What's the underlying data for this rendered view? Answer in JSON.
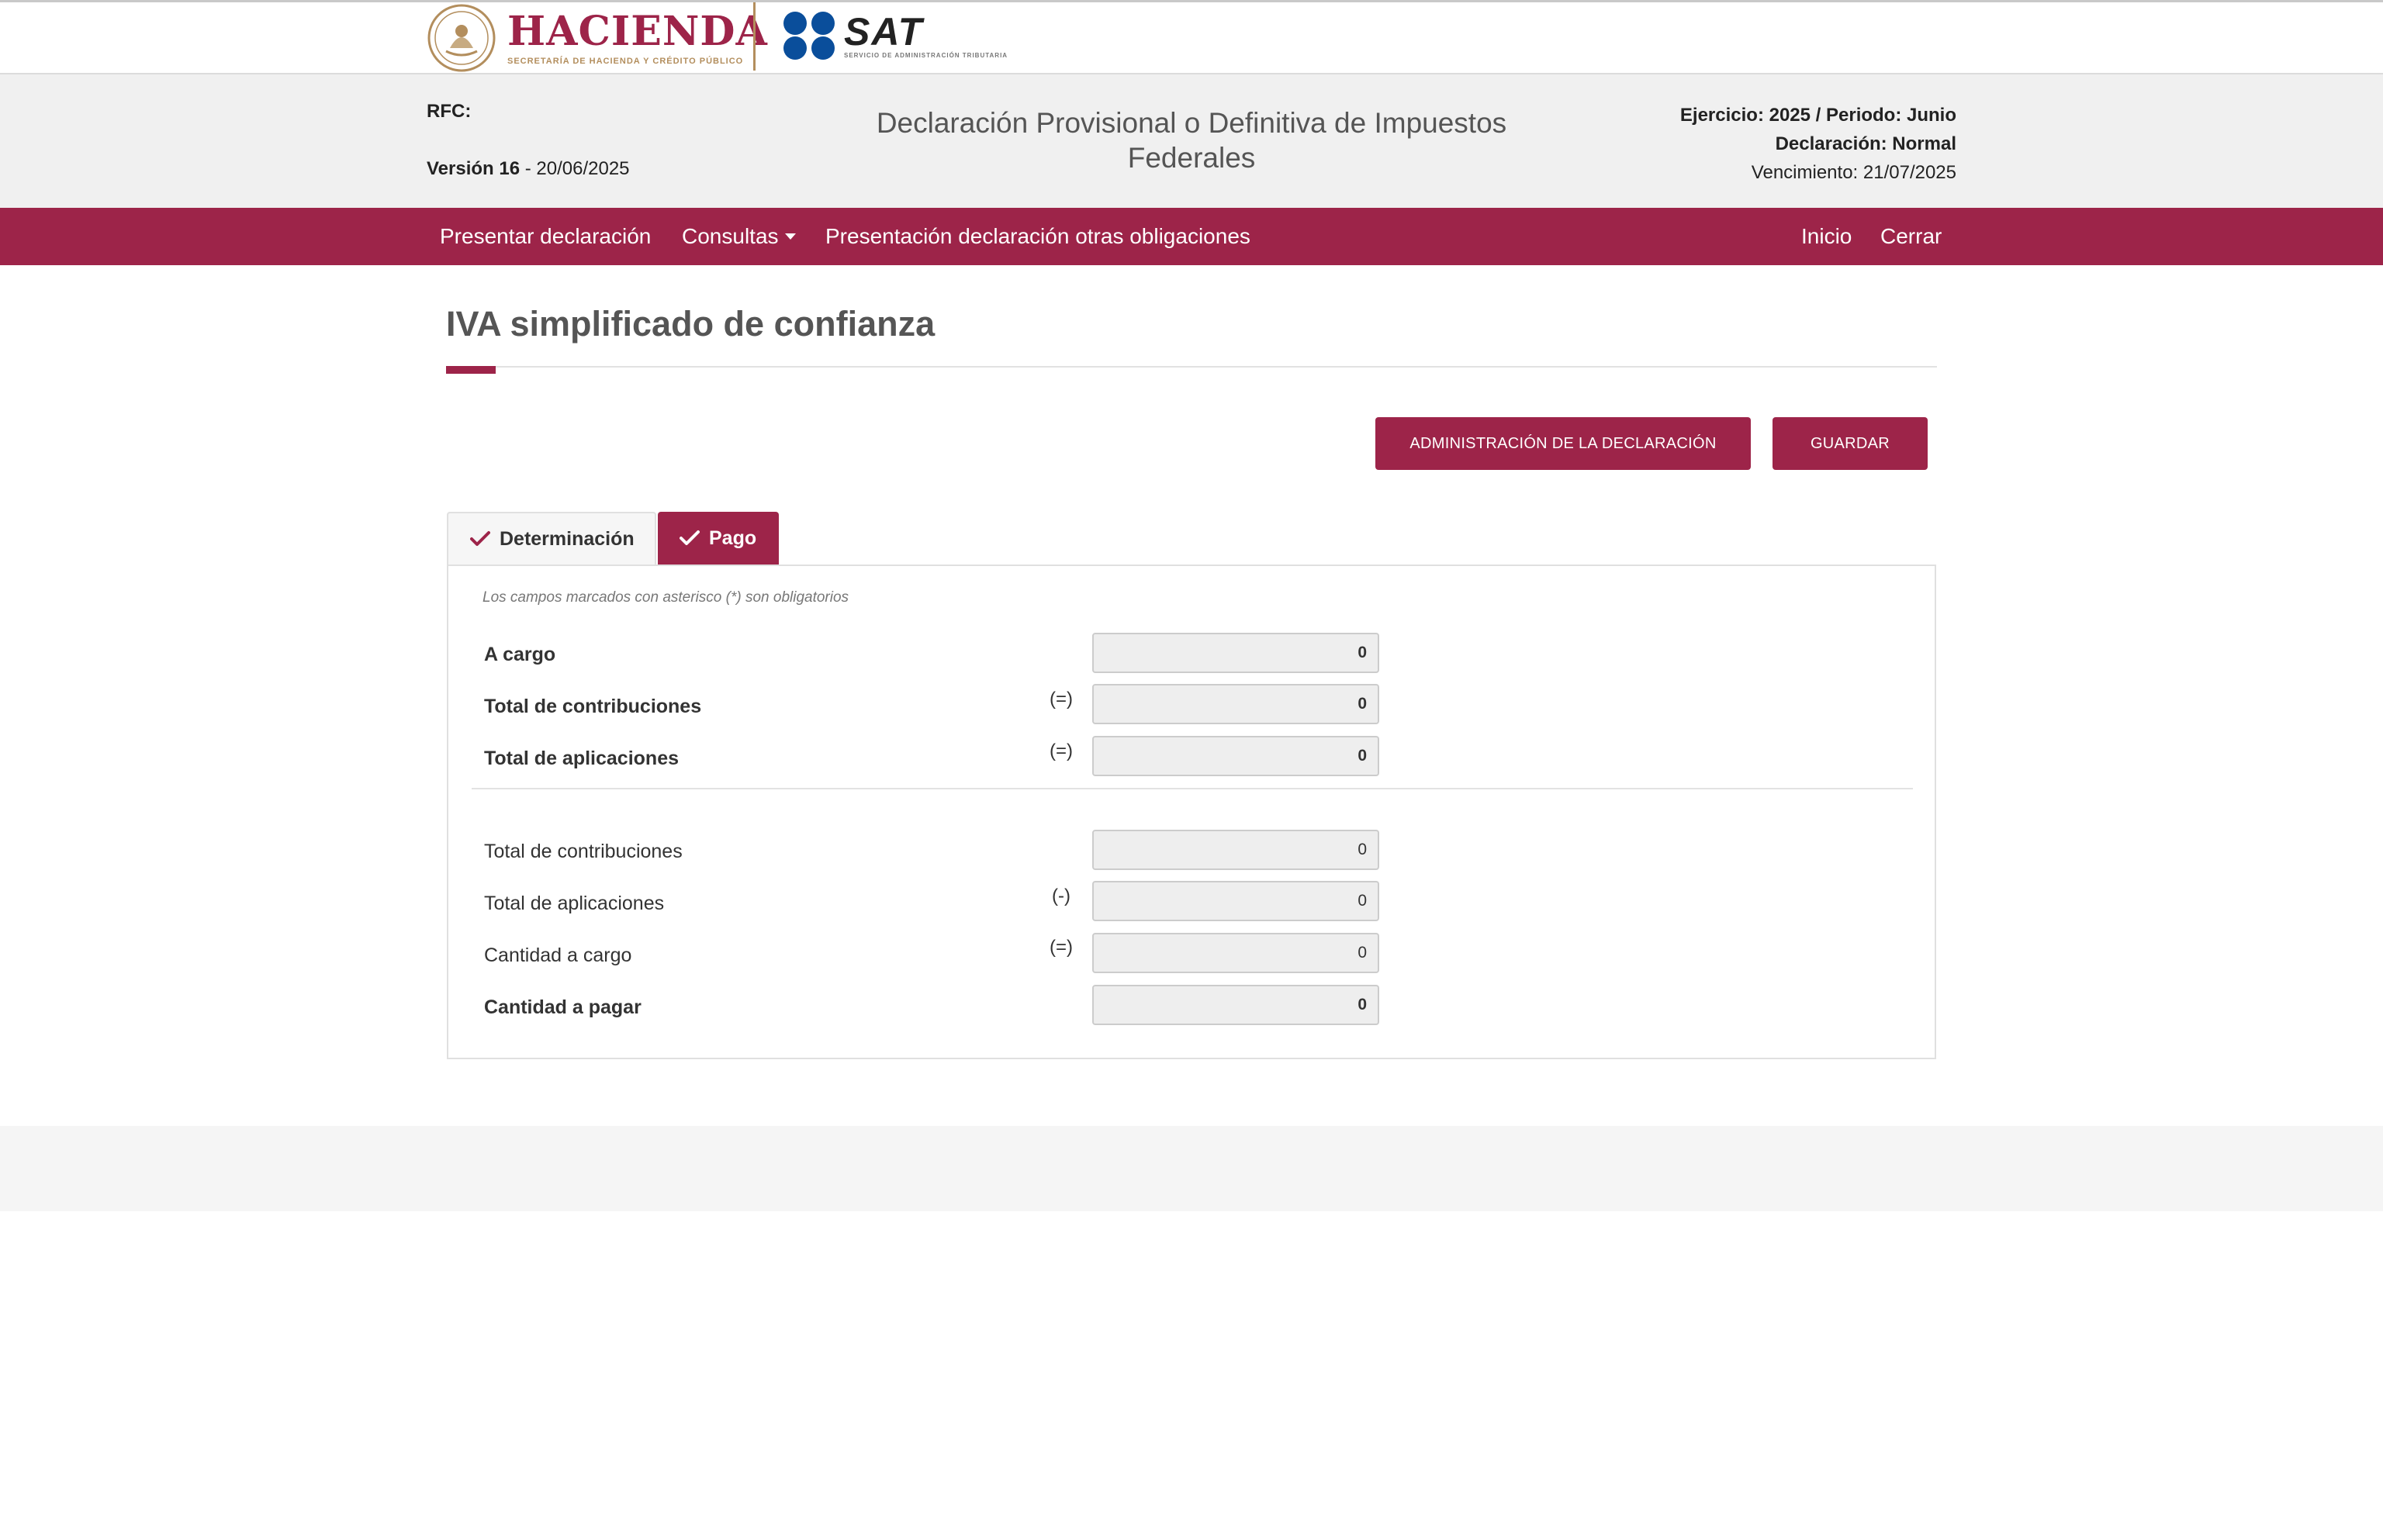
{
  "logos": {
    "hacienda_word": "HACIENDA",
    "hacienda_sub": "SECRETARÍA DE HACIENDA Y CRÉDITO PÚBLICO",
    "sat_word": "SAT",
    "sat_sub": "SERVICIO DE ADMINISTRACIÓN TRIBUTARIA"
  },
  "header": {
    "rfc_label": "RFC:",
    "version_label": "Versión 16",
    "version_date": " - 20/06/2025",
    "title": "Declaración Provisional o Definitiva de Impuestos Federales",
    "ejercicio": "Ejercicio: 2025 / Periodo: Junio",
    "declaracion": "Declaración: Normal",
    "vencimiento": "Vencimiento: 21/07/2025"
  },
  "nav": {
    "presentar": "Presentar declaración",
    "consultas": "Consultas",
    "otras": "Presentación declaración otras obligaciones",
    "inicio": "Inicio",
    "cerrar": "Cerrar"
  },
  "page": {
    "title": "IVA simplificado de confianza"
  },
  "buttons": {
    "admin": "ADMINISTRACIÓN DE LA DECLARACIÓN",
    "guardar": "GUARDAR"
  },
  "tabs": {
    "determinacion": "Determinación",
    "pago": "Pago"
  },
  "form": {
    "note": "Los campos marcados con asterisco (*) son obligatorios",
    "rows": [
      {
        "label": "A cargo",
        "op": "",
        "value": "0"
      },
      {
        "label": "Total de contribuciones",
        "op": "(=)",
        "value": "0"
      },
      {
        "label": "Total de aplicaciones",
        "op": "(=)",
        "value": "0"
      },
      {
        "label": "Total de contribuciones",
        "op": "",
        "value": "0"
      },
      {
        "label": "Total de aplicaciones",
        "op": "(-)",
        "value": "0"
      },
      {
        "label": "Cantidad a cargo",
        "op": "(=)",
        "value": "0"
      },
      {
        "label": "Cantidad a pagar",
        "op": "",
        "value": "0"
      }
    ]
  },
  "colors": {
    "brand": "#9d2449",
    "gold": "#b38e5d",
    "sat_blue": "#0a4e9b"
  }
}
